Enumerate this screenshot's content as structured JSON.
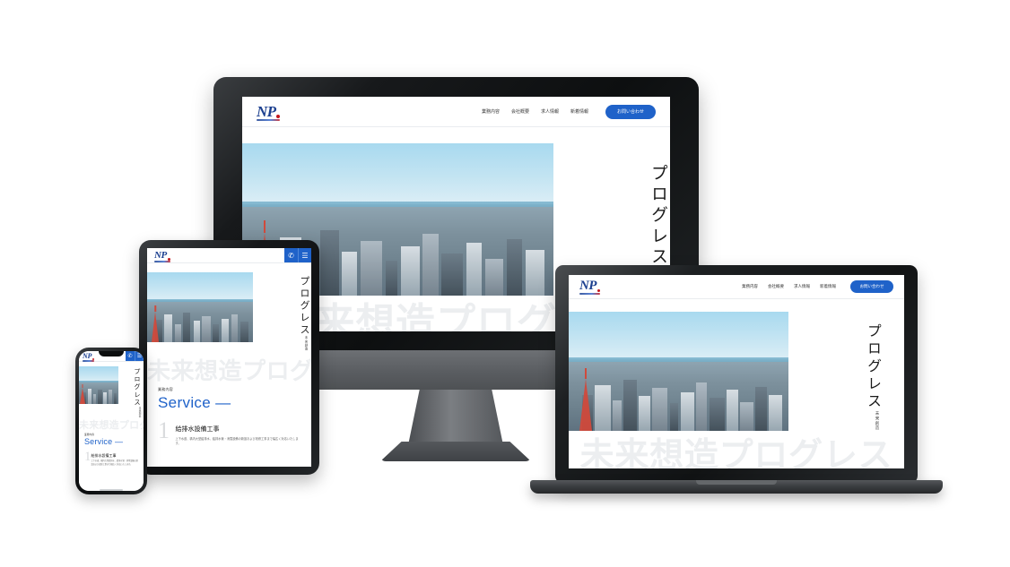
{
  "site": {
    "brand": {
      "name": "NP",
      "accent": "#1b3f8f",
      "dot_color": "#c4161c"
    },
    "nav": [
      {
        "label": "業務内容"
      },
      {
        "label": "会社概要"
      },
      {
        "label": "求人情報"
      },
      {
        "label": "新着情報"
      }
    ],
    "cta": {
      "label": "お問い合わせ",
      "color": "#1f62c9"
    },
    "mobile_actions": [
      {
        "name": "phone-icon",
        "glyph": "✆"
      },
      {
        "name": "hamburger-icon",
        "glyph": "☰"
      }
    ],
    "hero": {
      "vertical_small": "未来創造",
      "vertical_large": "プログレス",
      "watermark": "未来想造プログレス",
      "photo_alt": "東京タワーと東京湾を望む都市風景"
    },
    "service": {
      "kicker": "業務内容",
      "title": "Service",
      "dash": "—",
      "items": [
        {
          "number": "1",
          "heading": "給排水設備工事",
          "description": "上下水道、構内大型給排水、給排水管・消雪設備の新設および改修工事まで幅広く対応いたします。"
        }
      ]
    }
  },
  "devices": [
    {
      "name": "desktop-monitor",
      "type": "monitor"
    },
    {
      "name": "laptop",
      "type": "laptop"
    },
    {
      "name": "tablet",
      "type": "tablet"
    },
    {
      "name": "smartphone",
      "type": "phone"
    }
  ]
}
